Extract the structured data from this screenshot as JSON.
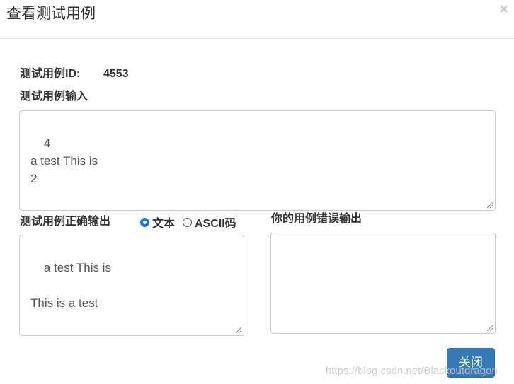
{
  "dialog": {
    "title": "查看测试用例",
    "close_symbol": "×"
  },
  "case": {
    "id_label": "测试用例ID:",
    "id_value": "4553",
    "input_label": "测试用例输入",
    "input_value": "4\na test This is\n2"
  },
  "expected": {
    "label": "测试用例正确输出",
    "radio_text_label": "文本",
    "radio_ascii_label": "ASCII码",
    "selected": "文本",
    "value": "a test This is\n\nThis is a test"
  },
  "wrong": {
    "label": "你的用例错误输出",
    "value": ""
  },
  "footer": {
    "close_button": "关闭"
  },
  "watermark": "https://blog.csdn.net/Blackoutdragon",
  "colors": {
    "primary_button": "#337ab7",
    "radio_checked": "#1a73e8",
    "border": "#cccccc"
  }
}
